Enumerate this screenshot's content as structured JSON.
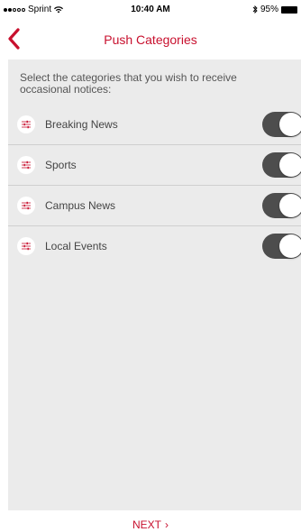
{
  "status_bar": {
    "carrier": "Sprint",
    "time": "10:40 AM",
    "battery_percent": "95%"
  },
  "nav": {
    "title": "Push Categories",
    "back_icon": "chevron-left-icon"
  },
  "intro_text": "Select the categories that you wish to receive occasional notices:",
  "categories": [
    {
      "label": "Breaking News",
      "enabled": true
    },
    {
      "label": "Sports",
      "enabled": true
    },
    {
      "label": "Campus News",
      "enabled": true
    },
    {
      "label": "Local Events",
      "enabled": true
    }
  ],
  "footer": {
    "next_label": "NEXT",
    "next_chevron": "›"
  },
  "colors": {
    "accent": "#c8102e",
    "panel": "#ebebeb",
    "toggle_on": "#4d4d4d"
  }
}
